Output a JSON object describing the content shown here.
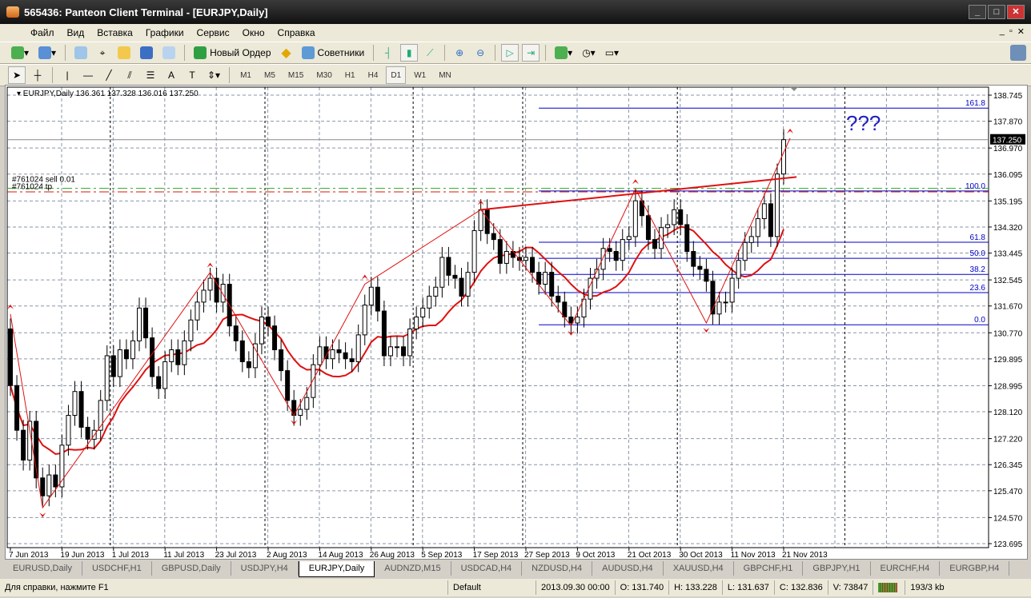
{
  "window": {
    "title": "565436: Panteon Client Terminal - [EURJPY,Daily]",
    "buttons": [
      "_",
      "□",
      "✕"
    ]
  },
  "menu": [
    "Файл",
    "Вид",
    "Вставка",
    "Графики",
    "Сервис",
    "Окно",
    "Справка"
  ],
  "toolbar": {
    "new_order": "Новый Ордер",
    "experts": "Советники"
  },
  "timeframes": [
    "M1",
    "M5",
    "M15",
    "M30",
    "H1",
    "H4",
    "D1",
    "W1",
    "MN"
  ],
  "active_timeframe": "D1",
  "chart_data": {
    "type": "candlestick",
    "header": "EURJPY,Daily  136.361 137.328 136.016 137.250",
    "last_price_label": "137.250",
    "last_price": 137.25,
    "ylim": [
      123.695,
      138.745
    ],
    "y_ticks": [
      "138.745",
      "137.870",
      "136.970",
      "136.095",
      "135.195",
      "134.320",
      "133.445",
      "132.545",
      "131.670",
      "130.770",
      "129.895",
      "128.995",
      "128.120",
      "127.220",
      "126.345",
      "125.470",
      "124.570",
      "123.695"
    ],
    "x_ticks": [
      {
        "bar": 0,
        "label": "7 Jun 2013"
      },
      {
        "bar": 8,
        "label": "19 Jun 2013"
      },
      {
        "bar": 16,
        "label": "1 Jul 2013"
      },
      {
        "bar": 24,
        "label": "11 Jul 2013"
      },
      {
        "bar": 32,
        "label": "23 Jul 2013"
      },
      {
        "bar": 40,
        "label": "2 Aug 2013"
      },
      {
        "bar": 48,
        "label": "14 Aug 2013"
      },
      {
        "bar": 56,
        "label": "26 Aug 2013"
      },
      {
        "bar": 64,
        "label": "5 Sep 2013"
      },
      {
        "bar": 72,
        "label": "17 Sep 2013"
      },
      {
        "bar": 80,
        "label": "27 Sep 2013"
      },
      {
        "bar": 88,
        "label": "9 Oct 2013"
      },
      {
        "bar": 96,
        "label": "21 Oct 2013"
      },
      {
        "bar": 104,
        "label": "30 Oct 2013"
      },
      {
        "bar": 112,
        "label": "11 Nov 2013"
      },
      {
        "bar": 120,
        "label": "21 Nov 2013"
      }
    ],
    "month_separators": [
      16,
      40,
      63,
      80,
      104,
      130
    ],
    "closes": [
      129.0,
      127.5,
      126.5,
      127.8,
      125.9,
      125.3,
      126.0,
      125.6,
      127.0,
      128.0,
      128.8,
      127.6,
      127.2,
      127.5,
      128.5,
      130.0,
      129.3,
      130.2,
      129.9,
      130.5,
      131.6,
      130.6,
      129.3,
      128.9,
      129.8,
      130.2,
      129.7,
      130.5,
      131.2,
      131.8,
      132.2,
      132.6,
      131.8,
      132.4,
      131.0,
      130.5,
      129.8,
      129.6,
      130.4,
      131.3,
      131.0,
      130.2,
      129.5,
      128.5,
      128.0,
      128.2,
      128.6,
      129.7,
      130.3,
      129.9,
      130.2,
      130.1,
      129.9,
      129.8,
      130.7,
      131.7,
      132.3,
      131.5,
      130.0,
      130.3,
      130.3,
      130.0,
      130.9,
      131.3,
      131.6,
      132.0,
      132.3,
      133.3,
      132.7,
      132.6,
      132.0,
      132.8,
      134.2,
      134.9,
      134.1,
      133.9,
      133.1,
      133.5,
      133.3,
      133.2,
      133.3,
      132.8,
      132.4,
      132.8,
      132.0,
      131.8,
      131.3,
      131.1,
      131.3,
      131.9,
      132.6,
      132.9,
      133.6,
      133.5,
      133.2,
      133.9,
      134.0,
      135.2,
      134.7,
      133.9,
      133.6,
      134.3,
      134.4,
      134.9,
      134.4,
      133.5,
      133.0,
      132.9,
      132.5,
      131.4,
      131.8,
      131.8,
      132.6,
      133.2,
      133.8,
      134.0,
      134.6,
      135.1,
      134.0,
      136.1,
      137.25
    ],
    "first_open": 130.9,
    "ma_period": 10,
    "zigzag": [
      [
        0,
        131.4
      ],
      [
        5,
        124.9
      ],
      [
        31,
        132.8
      ],
      [
        44,
        128.0
      ],
      [
        55,
        132.4
      ],
      [
        73,
        134.9
      ],
      [
        87,
        131.0
      ],
      [
        97,
        135.6
      ],
      [
        108,
        131.1
      ],
      [
        121,
        137.3
      ]
    ],
    "trendline": [
      [
        73,
        134.9
      ],
      [
        122,
        136.0
      ]
    ],
    "fibo": {
      "start_bar": 82,
      "levels": [
        {
          "label": "161.8",
          "price": 138.31
        },
        {
          "label": "100.0",
          "price": 135.53
        },
        {
          "label": "61.8",
          "price": 133.81
        },
        {
          "label": "50.0",
          "price": 133.27
        },
        {
          "label": "38.2",
          "price": 132.73
        },
        {
          "label": "23.6",
          "price": 132.12
        },
        {
          "label": "0.0",
          "price": 131.04
        }
      ]
    },
    "orders": {
      "sell_label": "#761024 sell 0.01",
      "sell_price": 135.5,
      "tp_label": "#761024 tp",
      "tp_price": 135.62
    },
    "annotation": "???"
  },
  "tabs": [
    "EURUSD,Daily",
    "USDCHF,H1",
    "GBPUSD,Daily",
    "USDJPY,H4",
    "EURJPY,Daily",
    "AUDNZD,M15",
    "USDCAD,H4",
    "NZDUSD,H4",
    "AUDUSD,H4",
    "XAUUSD,H4",
    "GBPCHF,H1",
    "GBPJPY,H1",
    "EURCHF,H4",
    "EURGBP,H4"
  ],
  "active_tab": "EURJPY,Daily",
  "status": {
    "help": "Для справки, нажмите F1",
    "profile": "Default",
    "time": "2013.09.30 00:00",
    "open": "O: 131.740",
    "high": "H: 133.228",
    "low": "L: 131.637",
    "close": "C: 132.836",
    "volume": "V: 73847",
    "traffic": "193/3 kb"
  }
}
